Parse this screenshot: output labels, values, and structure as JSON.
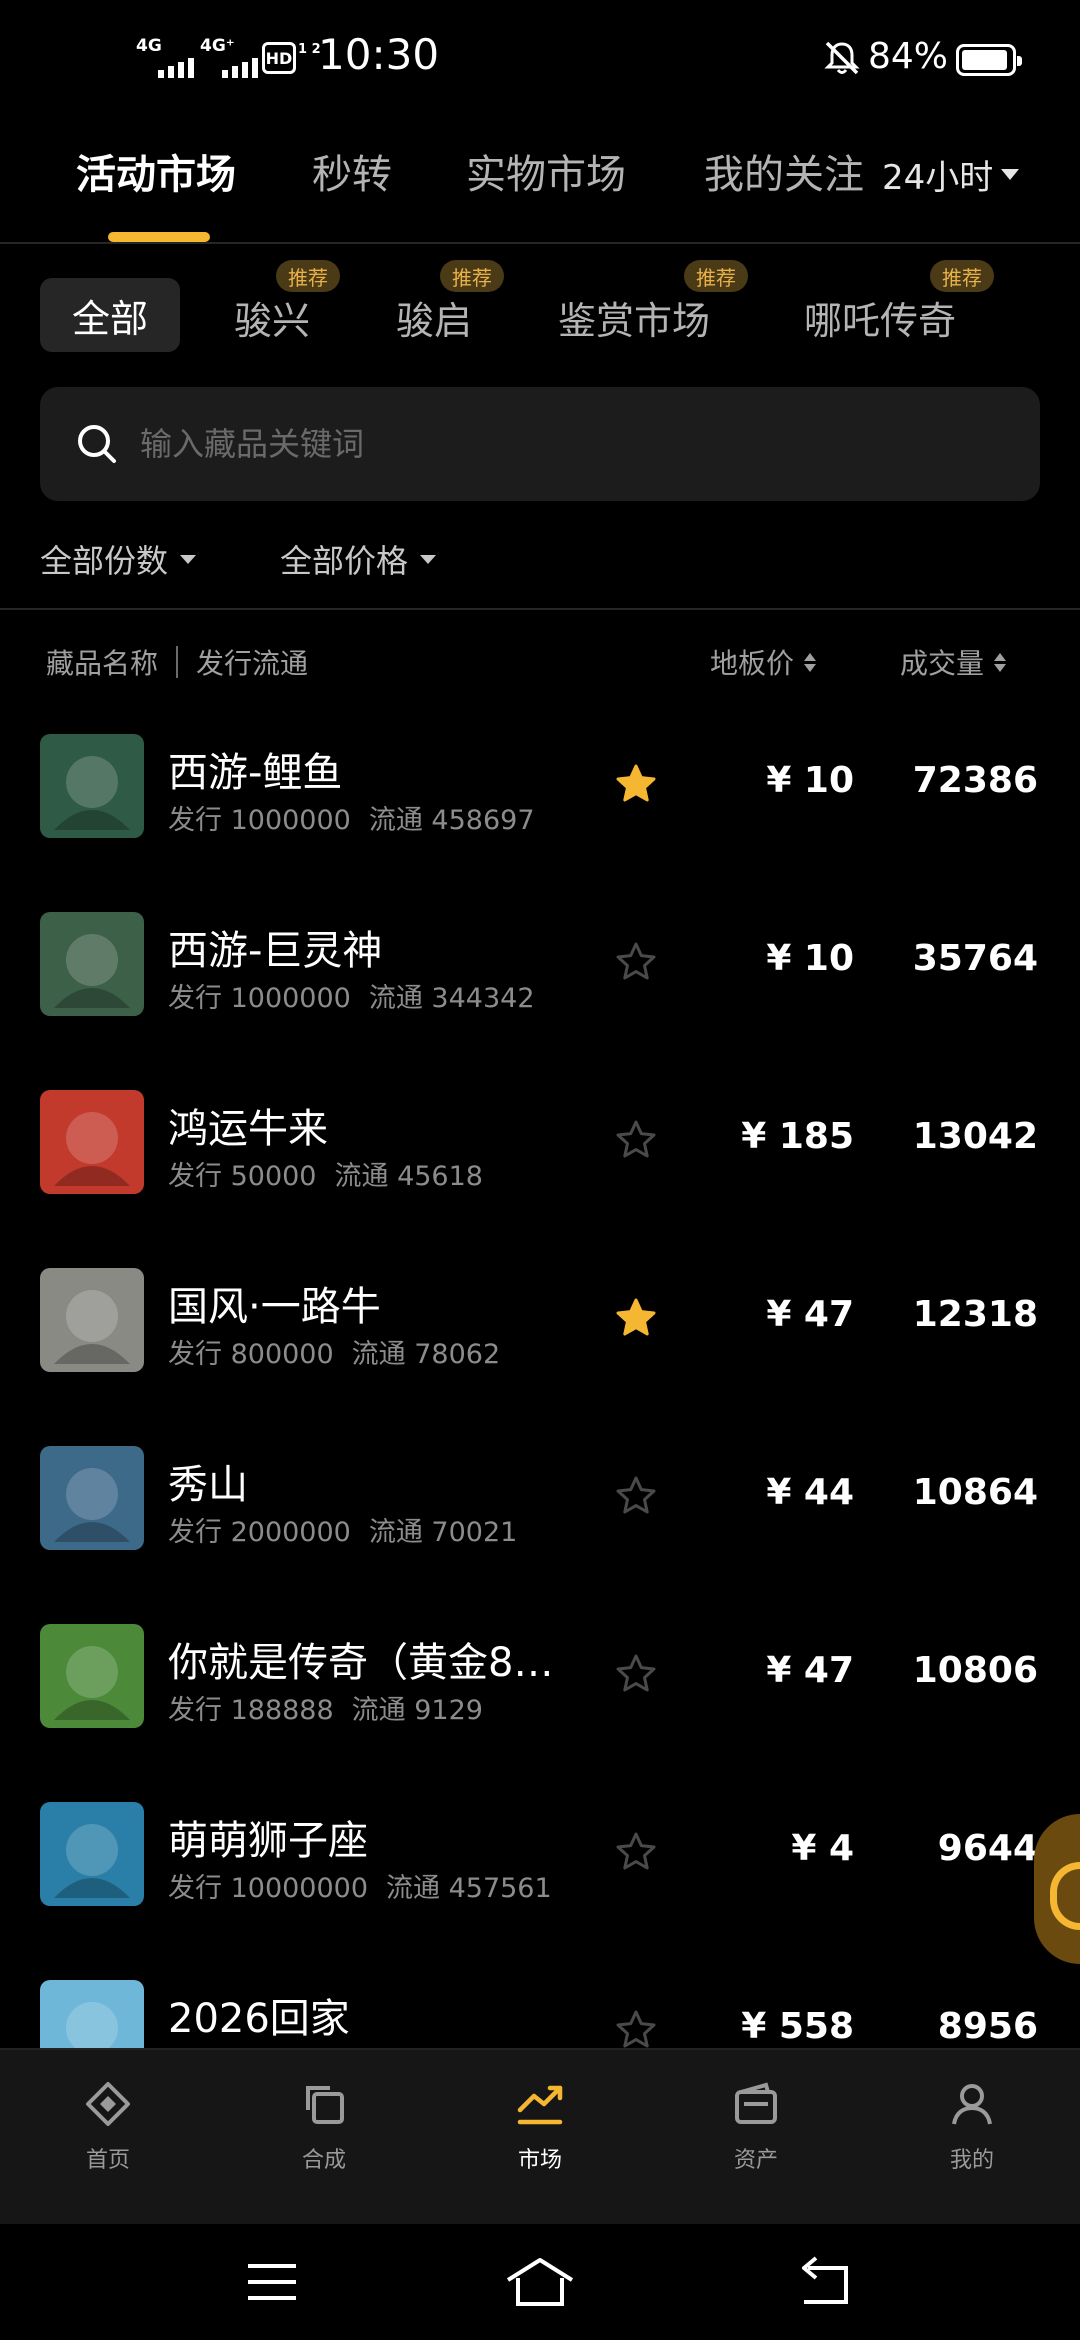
{
  "status_bar": {
    "signal1": "4G",
    "signal2": "4G⁺",
    "hd": "HD",
    "hd_sub": "1 2",
    "time": "10:30",
    "battery": "84%",
    "battery_level": 0.84
  },
  "main_tabs": [
    {
      "label": "活动市场",
      "active": true
    },
    {
      "label": "秒转",
      "active": false
    },
    {
      "label": "实物市场",
      "active": false
    },
    {
      "label": "我的关注",
      "active": false
    }
  ],
  "period": "24小时",
  "categories": [
    {
      "label": "全部",
      "active": true,
      "badge": ""
    },
    {
      "label": "骏兴",
      "badge": "推荐"
    },
    {
      "label": "骏启",
      "badge": "推荐"
    },
    {
      "label": "鉴赏市场",
      "badge": "推荐"
    },
    {
      "label": "哪吒传奇",
      "badge": "推荐"
    }
  ],
  "search": {
    "placeholder": "输入藏品关键词"
  },
  "filters": {
    "count": "全部份数",
    "price": "全部价格"
  },
  "table_header": {
    "name": "藏品名称",
    "issue": "发行流通",
    "floor": "地板价",
    "volume": "成交量"
  },
  "items": [
    {
      "name": "西游-鲤鱼",
      "issue": "发行 1000000",
      "circ": "流通 458697",
      "favorite": true,
      "price": "¥ 10",
      "volume": "72386",
      "thumb_color": "#2f5a45"
    },
    {
      "name": "西游-巨灵神",
      "issue": "发行 1000000",
      "circ": "流通 344342",
      "favorite": false,
      "price": "¥ 10",
      "volume": "35764",
      "thumb_color": "#3d6048"
    },
    {
      "name": "鸿运牛来",
      "issue": "发行 50000",
      "circ": "流通 45618",
      "favorite": false,
      "price": "¥ 185",
      "volume": "13042",
      "thumb_color": "#c23a2c"
    },
    {
      "name": "国风·一路牛",
      "issue": "发行 800000",
      "circ": "流通 78062",
      "favorite": true,
      "price": "¥ 47",
      "volume": "12318",
      "thumb_color": "#8a8a85"
    },
    {
      "name": "秀山",
      "issue": "发行 2000000",
      "circ": "流通 70021",
      "favorite": false,
      "price": "¥ 44",
      "volume": "10864",
      "thumb_color": "#3e6a8a"
    },
    {
      "name": "你就是传奇（黄金8…",
      "issue": "发行 188888",
      "circ": "流通 9129",
      "favorite": false,
      "price": "¥ 47",
      "volume": "10806",
      "thumb_color": "#4c8a3a"
    },
    {
      "name": "萌萌狮子座",
      "issue": "发行 10000000",
      "circ": "流通 457561",
      "favorite": false,
      "price": "¥ 4",
      "volume": "9644",
      "thumb_color": "#2a7fa8"
    },
    {
      "name": "2026回家",
      "issue": "",
      "circ": "",
      "favorite": false,
      "price": "¥ 558",
      "volume": "8956",
      "thumb_color": "#6fb7d8"
    }
  ],
  "bottom_nav": [
    {
      "label": "首页",
      "icon": "home-diamond-icon",
      "active": false
    },
    {
      "label": "合成",
      "icon": "compose-icon",
      "active": false
    },
    {
      "label": "市场",
      "icon": "trend-chart-icon",
      "active": true
    },
    {
      "label": "资产",
      "icon": "wallet-icon",
      "active": false
    },
    {
      "label": "我的",
      "icon": "user-icon",
      "active": false
    }
  ],
  "colors": {
    "accent": "#f5b731",
    "badge_bg": "#4a3a15",
    "badge_text": "#e8b14a",
    "background": "#000000"
  }
}
